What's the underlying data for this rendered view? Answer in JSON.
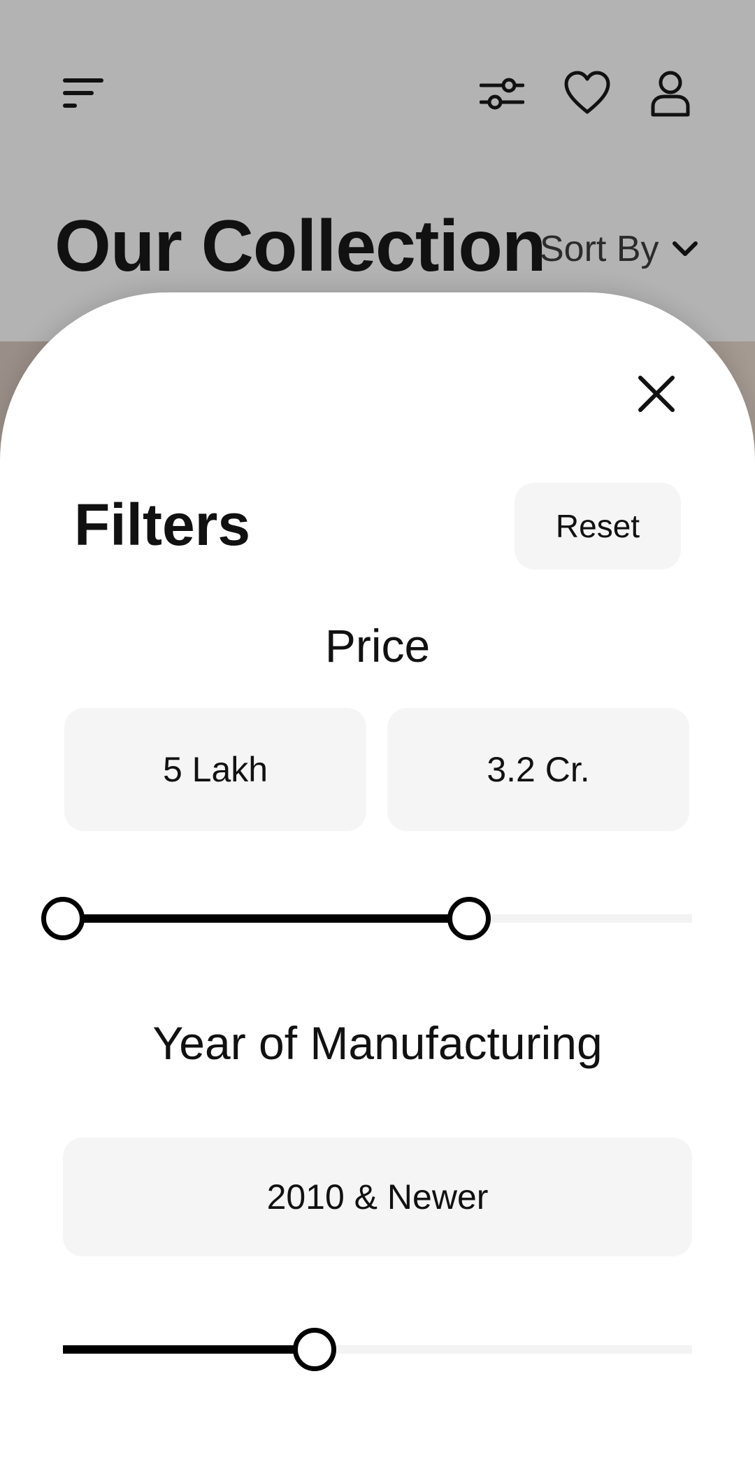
{
  "background": {
    "title": "Our Collection",
    "sort_label": "Sort By",
    "icons": {
      "menu": "menu-icon",
      "filter": "sliders-icon",
      "wishlist": "heart-icon",
      "profile": "user-icon",
      "sort": "chevron-down-icon"
    }
  },
  "filters_sheet": {
    "title": "Filters",
    "reset_label": "Reset",
    "close_icon": "close-icon",
    "price": {
      "heading": "Price",
      "min_label": "5 Lakh",
      "max_label": "3.2 Cr.",
      "range_fraction": [
        0.0,
        0.645
      ]
    },
    "year": {
      "heading": "Year of Manufacturing",
      "value_label": "2010 & Newer",
      "fraction": 0.4
    }
  },
  "colors": {
    "accent": "#000000",
    "scrim": "#b3b3b3",
    "surface": "#ffffff",
    "chip": "#f5f5f5"
  }
}
